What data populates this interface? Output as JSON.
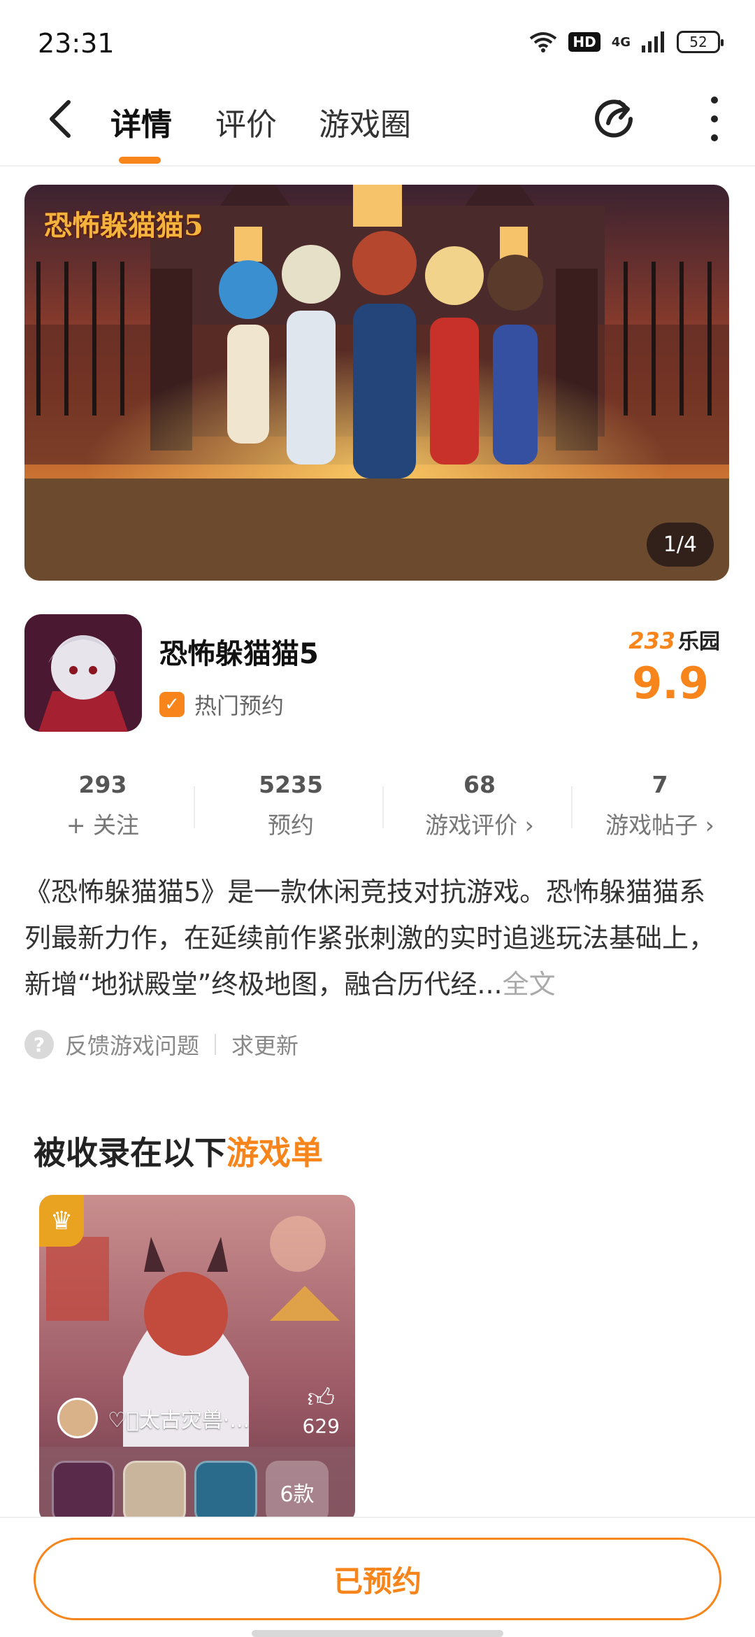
{
  "status_bar": {
    "time": "23:31",
    "hd": "HD",
    "network": "4G",
    "battery": "52"
  },
  "nav": {
    "tabs": [
      {
        "label": "详情",
        "active": true
      },
      {
        "label": "评价",
        "active": false
      },
      {
        "label": "游戏圈",
        "active": false
      }
    ],
    "icons": [
      "back-icon",
      "share-icon",
      "more-icon"
    ]
  },
  "banner": {
    "logo_text": "恐怖躲猫猫5",
    "counter": "1/4"
  },
  "app": {
    "title": "恐怖躲猫猫5",
    "badge": "热门预约",
    "brand_num": "233",
    "brand_name": "乐园",
    "score": "9.9"
  },
  "stats": [
    {
      "value": "293",
      "label": "+ 关注"
    },
    {
      "value": "5235",
      "label": "预约"
    },
    {
      "value": "68",
      "label": "游戏评价 ›"
    },
    {
      "value": "7",
      "label": "游戏帖子 ›"
    }
  ],
  "description": {
    "text": "《恐怖躲猫猫5》是一款休闲竞技对抗游戏。恐怖躲猫猫系列最新力作，在延续前作紧张刺激的实时追逃玩法基础上，新增“地狱殿堂”终极地图，融合历代经...",
    "more": "全文"
  },
  "feedback": {
    "report": "反馈游戏问题",
    "request": "求更新"
  },
  "collections": {
    "title_prefix": "被收录在以下",
    "title_highlight": "游戏单",
    "card": {
      "author": "♡ꦿ太古灾兽·...",
      "likes": "629",
      "game_count": "6款"
    }
  },
  "bottom": {
    "button_label": "已预约"
  },
  "colors": {
    "accent": "#f7851b",
    "trophy": "#e9a321"
  }
}
